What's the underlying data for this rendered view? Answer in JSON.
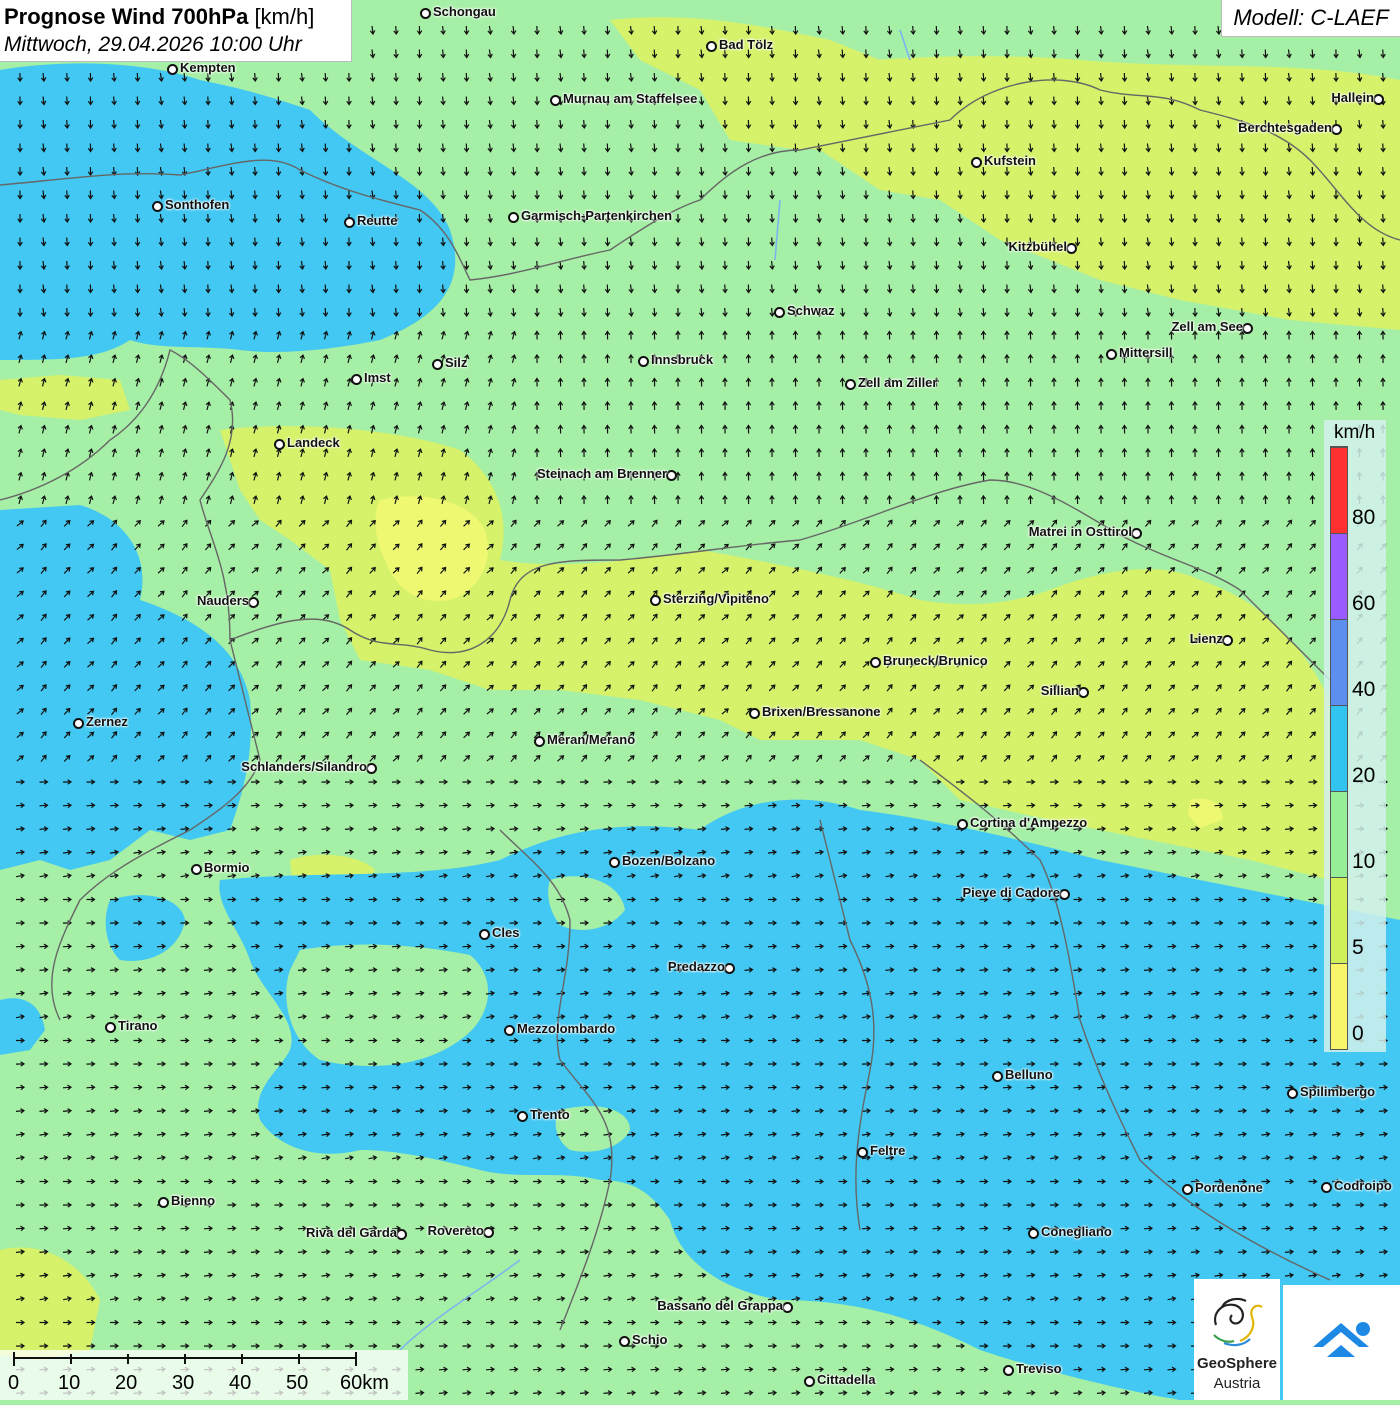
{
  "header": {
    "title_bold": "Prognose Wind 700hPa",
    "title_unit": "[km/h]",
    "datetime": "Mittwoch, 29.04.2026 10:00 Uhr",
    "model": "Modell: C-LAEF"
  },
  "cities": [
    {
      "name": "Schongau",
      "side": "right"
    },
    {
      "name": "Bad Tölz",
      "side": "right"
    },
    {
      "name": "Kempten",
      "side": "right"
    },
    {
      "name": "Murnau am Staffelsee",
      "side": "right"
    },
    {
      "name": "Hallein",
      "side": "left"
    },
    {
      "name": "Berchtesgaden",
      "side": "left"
    },
    {
      "name": "Kufstein",
      "side": "right"
    },
    {
      "name": "Sonthofen",
      "side": "right"
    },
    {
      "name": "Reutte",
      "side": "right"
    },
    {
      "name": "Garmisch-Partenkirchen",
      "side": "right"
    },
    {
      "name": "Kitzbühel",
      "side": "left"
    },
    {
      "name": "Schwaz",
      "side": "right"
    },
    {
      "name": "Zell am See",
      "side": "left"
    },
    {
      "name": "Mittersill",
      "side": "right"
    },
    {
      "name": "Innsbruck",
      "side": "right"
    },
    {
      "name": "Silz",
      "side": "right"
    },
    {
      "name": "Imst",
      "side": "right"
    },
    {
      "name": "Zell am Ziller",
      "side": "right"
    },
    {
      "name": "Landeck",
      "side": "right"
    },
    {
      "name": "Steinach am Brenner",
      "side": "left"
    },
    {
      "name": "Matrei in Osttirol",
      "side": "left"
    },
    {
      "name": "Nauders",
      "side": "left"
    },
    {
      "name": "Sterzing/Vipiteno",
      "side": "right"
    },
    {
      "name": "Lienz",
      "side": "left"
    },
    {
      "name": "Bruneck/Brunico",
      "side": "right"
    },
    {
      "name": "Sillian",
      "side": "left"
    },
    {
      "name": "Zernez",
      "side": "right"
    },
    {
      "name": "Brixen/Bressanone",
      "side": "right"
    },
    {
      "name": "Meran/Merano",
      "side": "right"
    },
    {
      "name": "Schlanders/Silandro",
      "side": "left"
    },
    {
      "name": "Cortina d'Ampezzo",
      "side": "right"
    },
    {
      "name": "Bozen/Bolzano",
      "side": "right"
    },
    {
      "name": "Bormio",
      "side": "right"
    },
    {
      "name": "Pieve di Cadore",
      "side": "left"
    },
    {
      "name": "Cles",
      "side": "right"
    },
    {
      "name": "Predazzo",
      "side": "left"
    },
    {
      "name": "Tirano",
      "side": "right"
    },
    {
      "name": "Mezzolombardo",
      "side": "right"
    },
    {
      "name": "Belluno",
      "side": "right"
    },
    {
      "name": "Spilimbergo",
      "side": "right"
    },
    {
      "name": "Trento",
      "side": "right"
    },
    {
      "name": "Feltre",
      "side": "right"
    },
    {
      "name": "Pordenone",
      "side": "right"
    },
    {
      "name": "Codroipo",
      "side": "right"
    },
    {
      "name": "Bienno",
      "side": "right"
    },
    {
      "name": "Riva del Garda",
      "side": "left"
    },
    {
      "name": "Rovereto",
      "side": "left"
    },
    {
      "name": "Conegliano",
      "side": "right"
    },
    {
      "name": "Bassano del Grappa",
      "side": "left"
    },
    {
      "name": "Schio",
      "side": "right"
    },
    {
      "name": "Treviso",
      "side": "right"
    },
    {
      "name": "Cittadella",
      "side": "right"
    }
  ],
  "legend": {
    "unit": "km/h",
    "ticks": [
      "80",
      "60",
      "40",
      "20",
      "10",
      "5",
      "0"
    ],
    "colors": [
      "#ff3030",
      "#9a5cff",
      "#5c8ff0",
      "#32c4f0",
      "#96ee96",
      "#d0f05a",
      "#f8f56a"
    ]
  },
  "scale": {
    "labels": [
      "0",
      "10",
      "20",
      "30",
      "40",
      "50",
      "60km"
    ]
  },
  "logo": {
    "line1": "GeoSphere",
    "line2": "Austria"
  },
  "wind_field": {
    "colors": {
      "calm": "#eef870",
      "light": "#d5f26a",
      "moderate": "#a6efa6",
      "fresh": "#42c8f2"
    }
  }
}
